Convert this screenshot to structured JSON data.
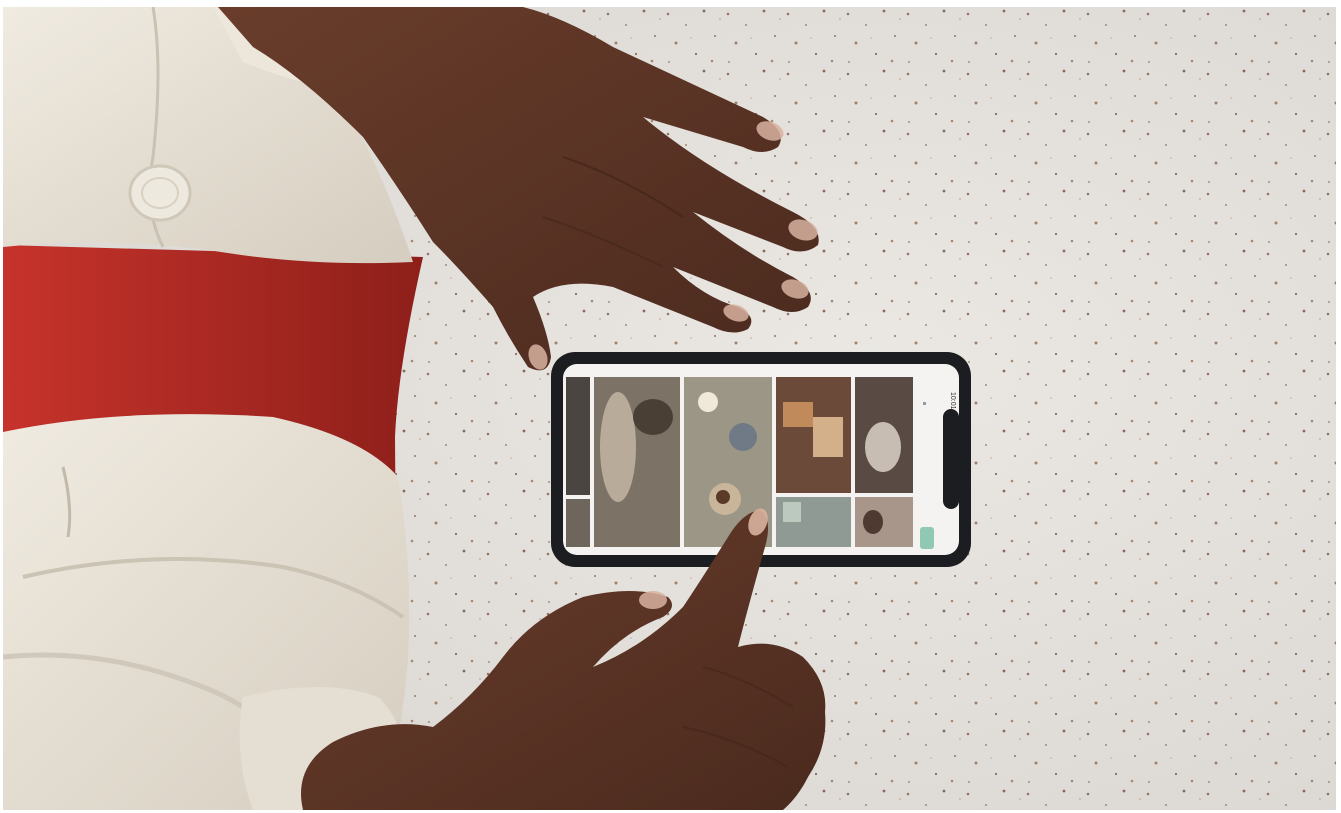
{
  "photo": {
    "subject": "",
    "palette": {
      "table": "#e4e1dd",
      "speckle_dark": "#8a6a55",
      "speckle_light": "#b9a596",
      "jacket": "#e8e2d6",
      "jacket_shadow": "#c9c1b2",
      "chair_red": "#b52a24",
      "skin": "#5a3424",
      "skin_highlight": "#7a4a35",
      "nail": "#d8b2a0",
      "phone_body": "#1c1d20",
      "screen_bg": "#f4f3f1",
      "accent_green": "#8fc8b3"
    },
    "phone": {
      "status_time": "10:01"
    }
  }
}
